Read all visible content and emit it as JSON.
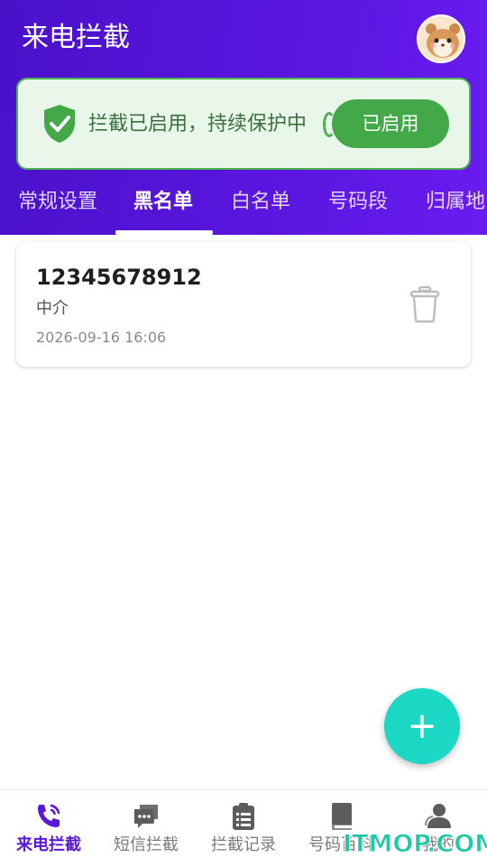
{
  "header": {
    "title": "来电拦截"
  },
  "status": {
    "text": "拦截已启用，持续保护中",
    "button_label": "已启用"
  },
  "tabs": [
    {
      "label": "常规设置",
      "active": false
    },
    {
      "label": "黑名单",
      "active": true
    },
    {
      "label": "白名单",
      "active": false
    },
    {
      "label": "号码段",
      "active": false
    },
    {
      "label": "归属地",
      "active": false
    }
  ],
  "blacklist": [
    {
      "number": "12345678912",
      "label": "中介",
      "time": "2026-09-16 16:06"
    }
  ],
  "fab": {
    "label": "+"
  },
  "bottom_nav": [
    {
      "label": "来电拦截",
      "icon": "phone-icon",
      "active": true
    },
    {
      "label": "短信拦截",
      "icon": "message-icon",
      "active": false
    },
    {
      "label": "拦截记录",
      "icon": "clipboard-icon",
      "active": false
    },
    {
      "label": "号码百科",
      "icon": "book-icon",
      "active": false
    },
    {
      "label": "我的",
      "icon": "person-icon",
      "active": false
    }
  ],
  "watermark": "ITMOP.COM",
  "colors": {
    "primary": "#5b16e0",
    "accent_green": "#43a847",
    "fab": "#1bd8c4"
  }
}
